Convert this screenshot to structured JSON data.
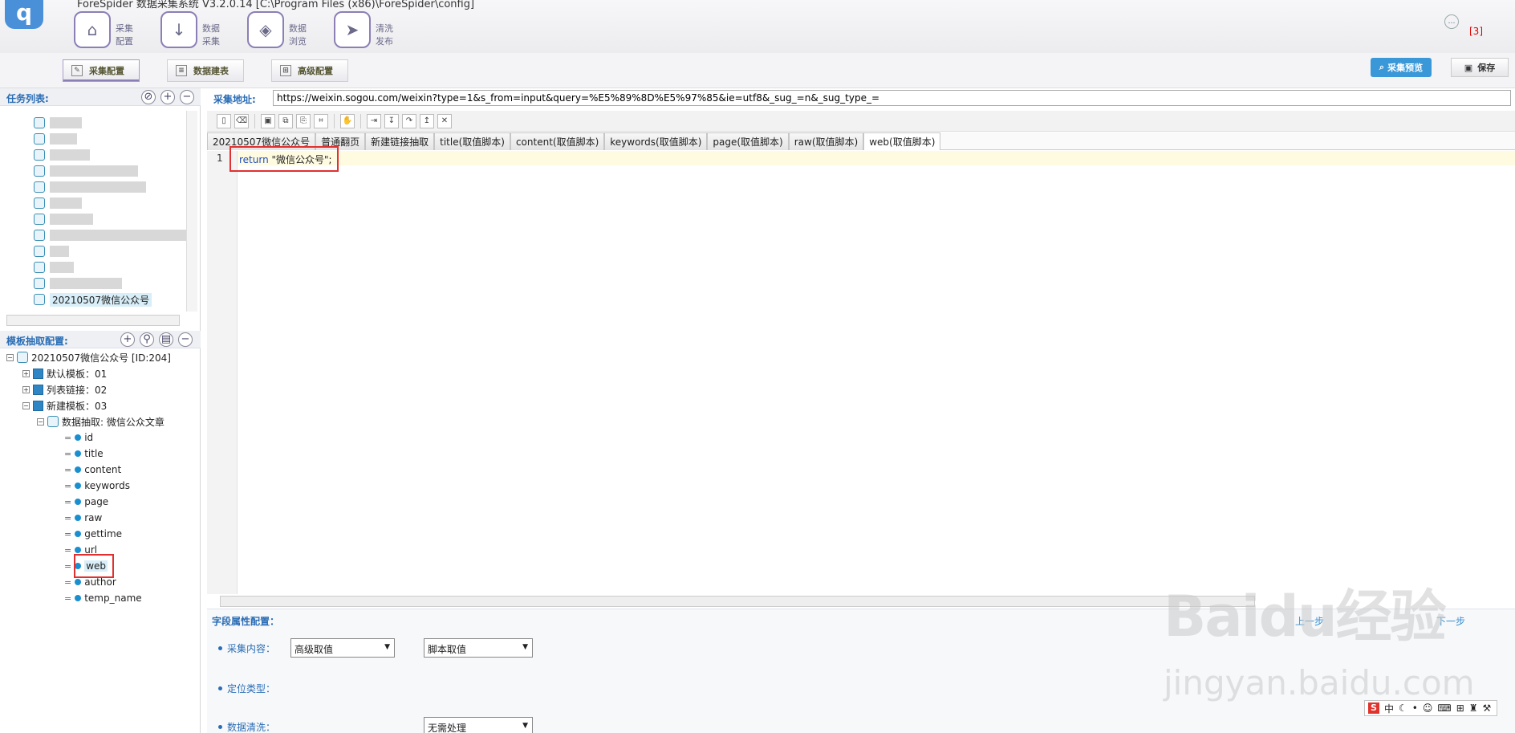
{
  "window": {
    "title": "ForeSpider 数据采集系统 V3.2.0.14 [C:\\Program Files (x86)\\ForeSpider\\config]",
    "notification_count": "[3]"
  },
  "nav": [
    {
      "label_line1": "采集",
      "label_line2": "配置",
      "icon": "home-icon"
    },
    {
      "label_line1": "数据",
      "label_line2": "采集",
      "icon": "download-icon"
    },
    {
      "label_line1": "数据",
      "label_line2": "浏览",
      "icon": "layers-icon"
    },
    {
      "label_line1": "清洗",
      "label_line2": "发布",
      "icon": "send-icon"
    }
  ],
  "subtabs": [
    {
      "label": "采集配置",
      "icon": "edit-icon"
    },
    {
      "label": "数据建表",
      "icon": "document-icon"
    },
    {
      "label": "高级配置",
      "icon": "grid-icon"
    }
  ],
  "toolbar": {
    "preview_label": "采集预览",
    "save_label": "保存"
  },
  "task_list": {
    "title": "任务列表:",
    "selected_task": "20210507微信公众号"
  },
  "template_config": {
    "title": "模板抽取配置:",
    "root": "20210507微信公众号 [ID:204]",
    "templates": [
      "默认模板：01",
      "列表链接：02",
      "新建模板：03"
    ],
    "extraction": "数据抽取: 微信公众文章",
    "fields": [
      "id",
      "title",
      "content",
      "keywords",
      "page",
      "raw",
      "gettime",
      "url",
      "web",
      "author",
      "temp_name"
    ]
  },
  "url_bar": {
    "label": "采集地址:",
    "value": "https://weixin.sogou.com/weixin?type=1&s_from=input&query=%E5%89%8D%E5%97%85&ie=utf8&_sug_=n&_sug_type_="
  },
  "script_tabs": [
    "20210507微信公众号",
    "普通翻页",
    "新建链接抽取",
    "title(取值脚本)",
    "content(取值脚本)",
    "keywords(取值脚本)",
    "page(取值脚本)",
    "raw(取值脚本)",
    "web(取值脚本)"
  ],
  "editor": {
    "line_number": "1",
    "keyword": "return",
    "string": " \"微信公众号\";"
  },
  "field_config": {
    "title": "字段属性配置：",
    "prev_label": "上一步",
    "next_label": "下一步",
    "collect_label": "采集内容：",
    "collect_value1": "高级取值",
    "collect_value2": "脚本取值",
    "locate_label": "定位类型：",
    "clean_label": "数据清洗：",
    "clean_value": "无需处理"
  },
  "watermark": {
    "line1": "Baidu经验",
    "line2": "jingyan.baidu.com"
  },
  "ime": {
    "badge": "S",
    "mode": "中"
  }
}
